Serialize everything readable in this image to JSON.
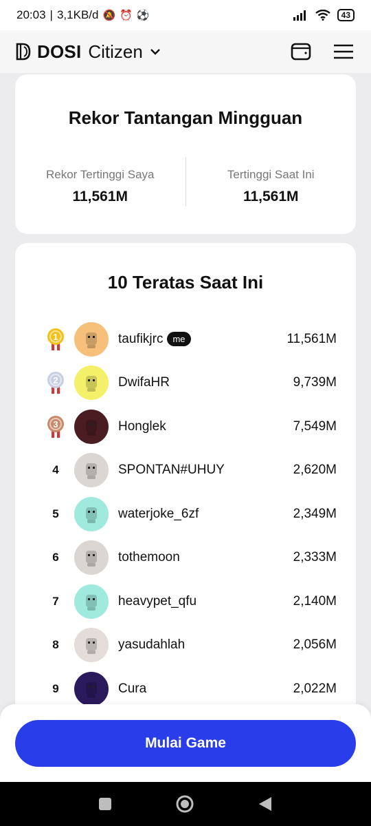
{
  "status_bar": {
    "time": "20:03",
    "speed": "3,1KB/d",
    "battery": "43"
  },
  "header": {
    "brand": "DOSI",
    "sub": "Citizen"
  },
  "record": {
    "title": "Rekor Tantangan Mingguan",
    "my_label": "Rekor Tertinggi Saya",
    "my_value": "11,561M",
    "top_label": "Tertinggi Saat Ini",
    "top_value": "11,561M"
  },
  "leaderboard": {
    "title": "10 Teratas Saat Ini",
    "me_badge": "me",
    "rows": [
      {
        "rank": "1",
        "name": "taufikjrc",
        "score": "11,561M",
        "avatar_color": "#f6c07a",
        "is_me": true
      },
      {
        "rank": "2",
        "name": "DwifaHR",
        "score": "9,739M",
        "avatar_color": "#f4f06a"
      },
      {
        "rank": "3",
        "name": "Honglek",
        "score": "7,549M",
        "avatar_color": "#4a1d22"
      },
      {
        "rank": "4",
        "name": "SPONTAN#UHUY",
        "score": "2,620M",
        "avatar_color": "#d9d6d4"
      },
      {
        "rank": "5",
        "name": "waterjoke_6zf",
        "score": "2,349M",
        "avatar_color": "#9feadd"
      },
      {
        "rank": "6",
        "name": "tothemoon",
        "score": "2,333M",
        "avatar_color": "#d9d6d4"
      },
      {
        "rank": "7",
        "name": "heavypet_qfu",
        "score": "2,140M",
        "avatar_color": "#9feadd"
      },
      {
        "rank": "8",
        "name": "yasudahlah",
        "score": "2,056M",
        "avatar_color": "#e3dcd8"
      },
      {
        "rank": "9",
        "name": "Cura",
        "score": "2,022M",
        "avatar_color": "#2b1a5c"
      }
    ]
  },
  "cta": {
    "label": "Mulai Game"
  },
  "colors": {
    "accent": "#2a3deb",
    "gold": "#f2c21b",
    "silver": "#c9cfe0",
    "bronze": "#c98a6a"
  },
  "icons": {
    "wallet": "wallet-icon",
    "menu": "menu-icon",
    "chevron": "chevron-down-icon"
  }
}
